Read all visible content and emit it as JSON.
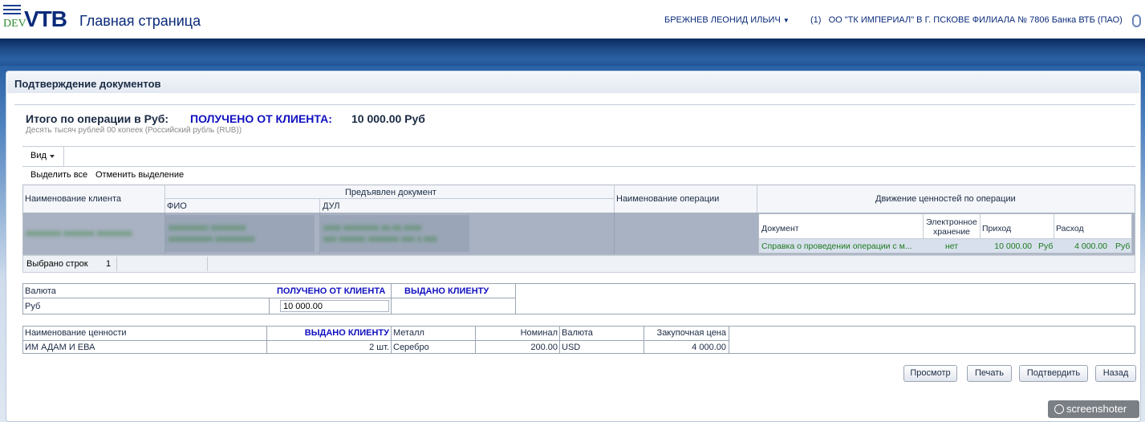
{
  "header": {
    "logo_dev": "DEV",
    "logo_vtb": "VTB",
    "title": "Главная страница",
    "user": "БРЕЖНЕВ ЛЕОНИД ИЛЬИЧ",
    "branch": "(1)   ОО \"ТК ИМПЕРИАЛ\" В Г. ПСКОВЕ ФИЛИАЛА № 7806 Банка ВТБ (ПАО)"
  },
  "panel": {
    "title": "Подтверждение документов"
  },
  "summary": {
    "label": "Итого по операции в Руб:",
    "status": "ПОЛУЧЕНО ОТ КЛИЕНТА:",
    "amount": "10 000.00 Руб",
    "amount_words": "Десять тысяч рублей 00 копеек (Российский рубль (RUB))"
  },
  "toolbar": {
    "view": "Вид",
    "select_all": "Выделить все",
    "deselect": "Отменить выделение"
  },
  "grid": {
    "headers": {
      "client_name": "Наименование клиента",
      "document_presented": "Предъявлен документ",
      "fio": "ФИО",
      "dul": "ДУЛ",
      "operation_name": "Наименование операции",
      "movement": "Движение ценностей по операции"
    },
    "row": {
      "client_name": "xxxxxxxx xxxxxxx xxxxxxxx",
      "fio_line1": "xxxxxxxxx xxxxxxxx",
      "fio_line2": "xxxxxxxxxx xxxxxxxxx",
      "dul_line1": "xxxx xxxxxxxx xx.xx.xxxx",
      "dul_line2": "xxx xxxxxx xxxxxxx xxx x xxx",
      "operation_name": ""
    },
    "subgrid": {
      "headers": {
        "document": "Документ",
        "storage": "Электронное хранение",
        "income": "Приход",
        "expense": "Расход"
      },
      "row": {
        "document": "Справка о проведении операции с м...",
        "storage": "нет",
        "income": "10 000.00",
        "income_cur": "Руб",
        "expense": "4 000.00",
        "expense_cur": "Руб"
      }
    },
    "selected_label": "Выбрано строк",
    "selected_count": "1"
  },
  "currency_table": {
    "headers": {
      "currency": "Валюта",
      "received": "ПОЛУЧЕНО ОТ КЛИЕНТА",
      "issued": "ВЫДАНО КЛИЕНТУ"
    },
    "row": {
      "currency": "Руб",
      "received_value": "10 000.00",
      "issued_value": ""
    }
  },
  "valuables_table": {
    "headers": {
      "name": "Наименование ценности",
      "issued": "ВЫДАНО КЛИЕНТУ",
      "metal": "Металл",
      "nominal": "Номинал",
      "currency": "Валюта",
      "price": "Закупочная цена"
    },
    "row": {
      "name": "ИМ АДАМ И ЕВА",
      "issued": "2 шт.",
      "metal": "Серебро",
      "nominal": "200.00",
      "currency": "USD",
      "price": "4 000.00"
    }
  },
  "buttons": {
    "preview": "Просмотр",
    "print": "Печать",
    "confirm": "Подтвердить",
    "back": "Назад"
  },
  "watermark": "screenshoter",
  "colors": {
    "brand": "#0a2a7a",
    "accent_blue": "#1010c0",
    "green_text": "#1f7a1f",
    "selected_row": "#a9b2c2"
  }
}
